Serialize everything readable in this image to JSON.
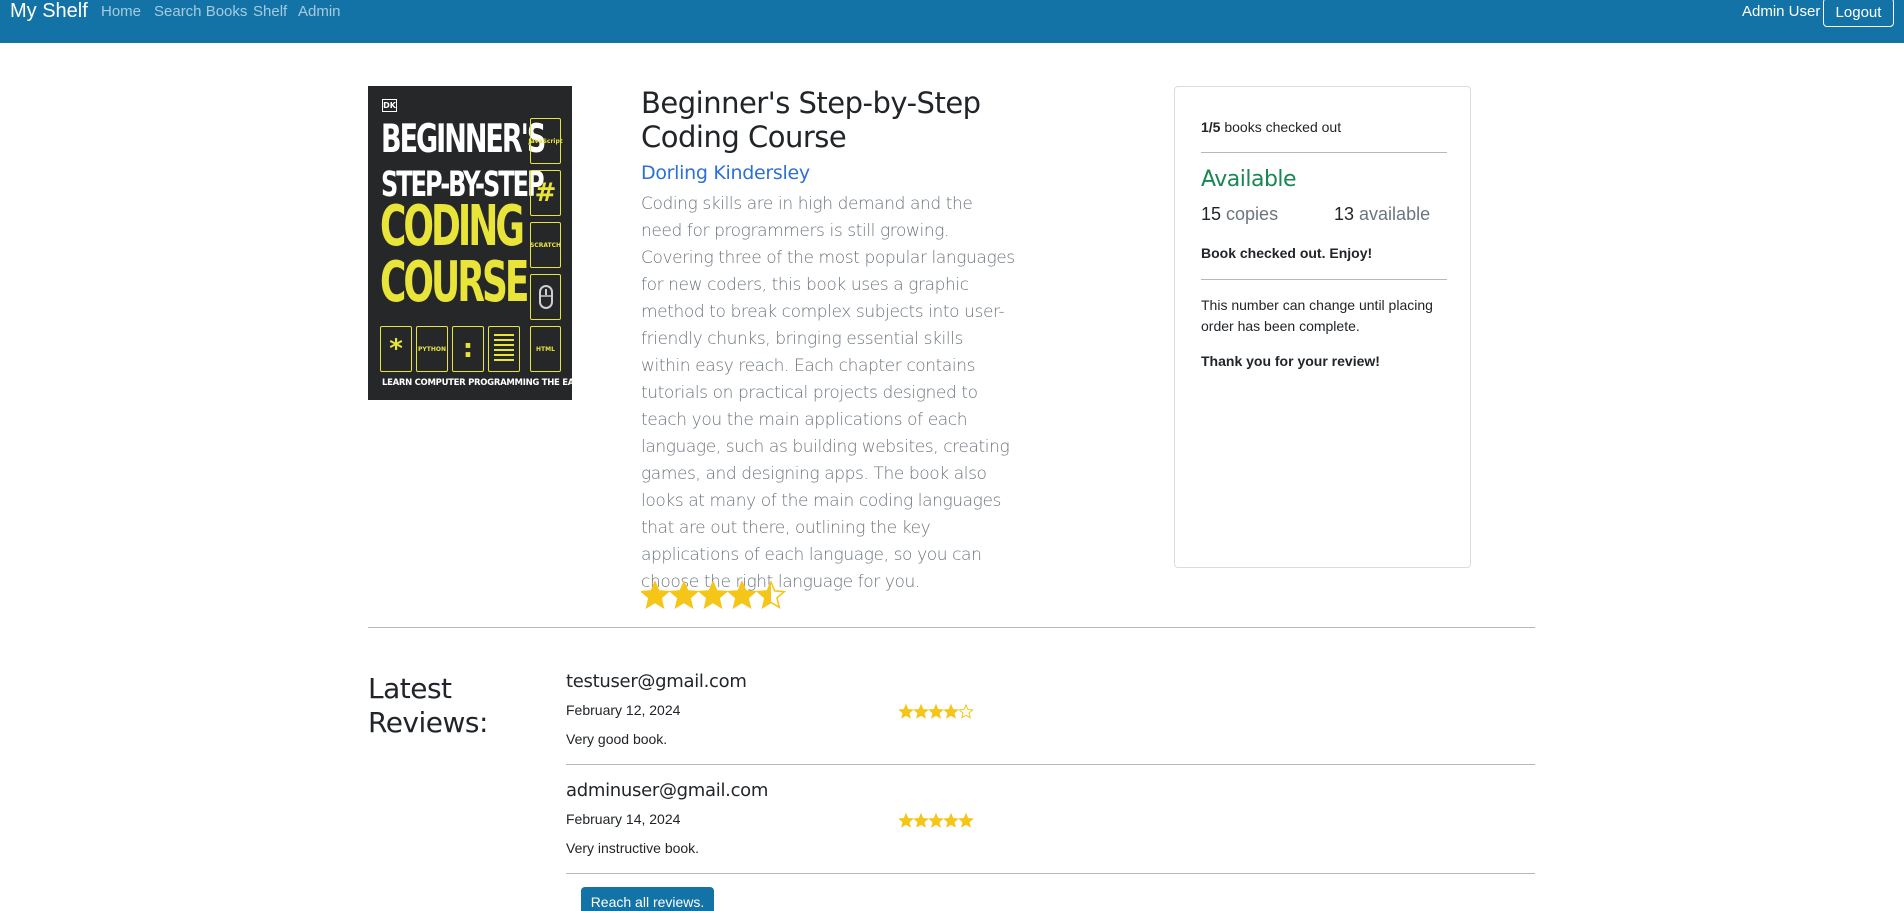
{
  "navbar": {
    "brand": "My Shelf",
    "links": [
      "Home",
      "Search Books",
      "Shelf",
      "Admin"
    ],
    "user_name": "Admin User",
    "logout_label": "Logout",
    "background": "#1373a6"
  },
  "book": {
    "title": "Beginner's Step-by-Step Coding Course",
    "author": "Dorling Kindersley",
    "description": "Coding skills are in high demand and the need for programmers is still growing. Covering three of the most popular languages for new coders, this book uses a graphic method to break complex subjects into user-friendly chunks, bringing essential skills within easy reach. Each chapter contains tutorials on practical projects designed to teach you the main applications of each language, such as building websites, creating games, and designing apps. The book also looks at many of the main coding languages that are out there, outlining the key applications of each language, so you can choose the right language for you.",
    "rating": 4.5,
    "cover": {
      "publisher_mark": "DK",
      "line1": "BEGINNER'S",
      "line2": "STEP-BY-STEP",
      "line3": "CODING",
      "line4": "COURSE",
      "box_javascript": "JavaScript",
      "box_hash": "#",
      "box_scratch": "SCRATCH",
      "box_star": "*",
      "box_python": "PYTHON",
      "box_colon": ":",
      "box_html": "HTML",
      "tagline": "LEARN COMPUTER PROGRAMMING THE EASY WAY"
    }
  },
  "checkout_card": {
    "checked_out_count": "1/5",
    "checked_out_label": " books checked out",
    "status": "Available",
    "copies_count": "15",
    "copies_label": " copies",
    "available_count": "13",
    "available_label": " available",
    "message": "Book checked out. Enjoy!",
    "note": "This number can change until placing order has been complete.",
    "thanks": "Thank you for your review!"
  },
  "reviews": {
    "heading": "Latest Reviews:",
    "items": [
      {
        "email": "testuser@gmail.com",
        "date": "February 12, 2024",
        "text": "Very good book.",
        "rating": 4
      },
      {
        "email": "adminuser@gmail.com",
        "date": "February 14, 2024",
        "text": "Very instructive book.",
        "rating": 5
      }
    ],
    "reach_all_label": "Reach all reviews."
  },
  "colors": {
    "star": "#f5c518",
    "available": "#198754",
    "author_link": "#2f6fd8"
  }
}
